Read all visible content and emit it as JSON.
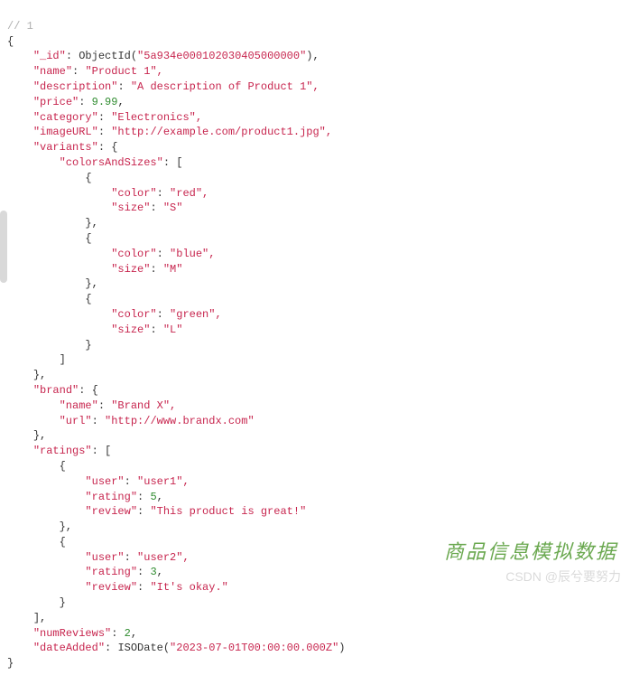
{
  "comment": "// 1",
  "doc": {
    "_id_key": "\"_id\"",
    "_id_call": "ObjectId(",
    "_id_val": "\"5a934e000102030405000000\"",
    "_id_close": "),",
    "name_key": "\"name\"",
    "name_val": "\"Product 1\",",
    "description_key": "\"description\"",
    "description_val": "\"A description of Product 1\",",
    "price_key": "\"price\"",
    "price_val": "9.99",
    "category_key": "\"category\"",
    "category_val": "\"Electronics\",",
    "imageURL_key": "\"imageURL\"",
    "imageURL_val": "\"http://example.com/product1.jpg\",",
    "variants_key": "\"variants\"",
    "colorsAndSizes_key": "\"colorsAndSizes\"",
    "variants": [
      {
        "color_key": "\"color\"",
        "color_val": "\"red\",",
        "size_key": "\"size\"",
        "size_val": "\"S\""
      },
      {
        "color_key": "\"color\"",
        "color_val": "\"blue\",",
        "size_key": "\"size\"",
        "size_val": "\"M\""
      },
      {
        "color_key": "\"color\"",
        "color_val": "\"green\",",
        "size_key": "\"size\"",
        "size_val": "\"L\""
      }
    ],
    "brand_key": "\"brand\"",
    "brand_name_key": "\"name\"",
    "brand_name_val": "\"Brand X\",",
    "brand_url_key": "\"url\"",
    "brand_url_val": "\"http://www.brandx.com\"",
    "ratings_key": "\"ratings\"",
    "ratings": [
      {
        "user_key": "\"user\"",
        "user_val": "\"user1\",",
        "rating_key": "\"rating\"",
        "rating_val": "5",
        "review_key": "\"review\"",
        "review_val": "\"This product is great!\""
      },
      {
        "user_key": "\"user\"",
        "user_val": "\"user2\",",
        "rating_key": "\"rating\"",
        "rating_val": "3",
        "review_key": "\"review\"",
        "review_val": "\"It's okay.\""
      }
    ],
    "numReviews_key": "\"numReviews\"",
    "numReviews_val": "2",
    "dateAdded_key": "\"dateAdded\"",
    "dateAdded_call": "ISODate(",
    "dateAdded_val": "\"2023-07-01T00:00:00.000Z\"",
    "dateAdded_close": ")"
  },
  "watermark_main": "商品信息模拟数据",
  "watermark_sub": "CSDN @辰兮要努力"
}
